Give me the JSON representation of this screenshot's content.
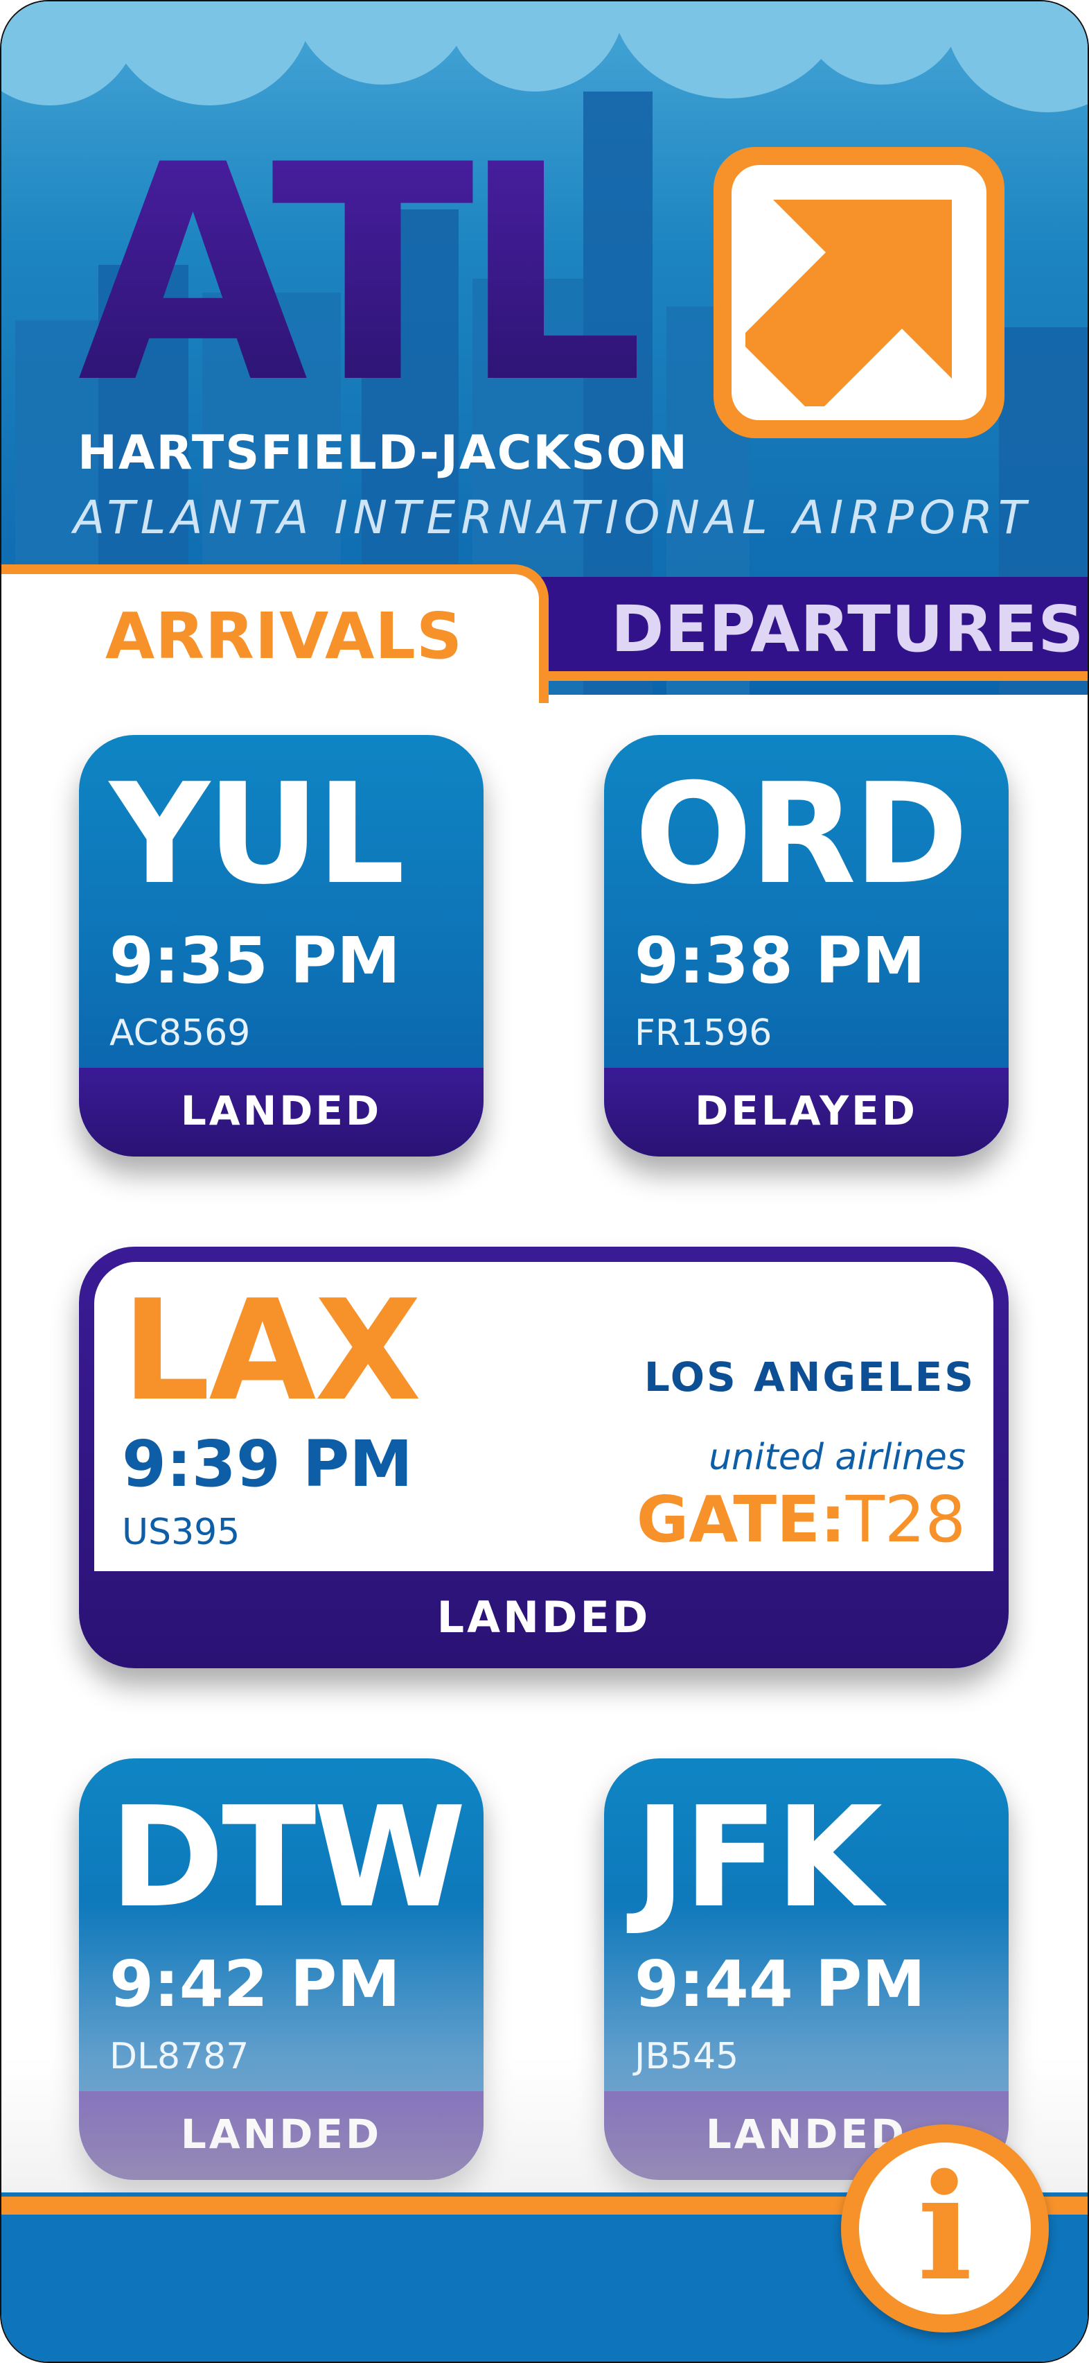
{
  "header": {
    "airport_code": "ATL",
    "name_line1": "HARTSFIELD-JACKSON",
    "name_line2": "ATLANTA INTERNATIONAL AIRPORT",
    "logo_icon": "arrow-up-right-icon"
  },
  "tabs": [
    {
      "label": "ARRIVALS",
      "active": true
    },
    {
      "label": "DEPARTURES",
      "active": false
    }
  ],
  "flights": [
    {
      "code": "YUL",
      "time": "9:35 PM",
      "flight": "AC8569",
      "status": "LANDED"
    },
    {
      "code": "ORD",
      "time": "9:38 PM",
      "flight": "FR1596",
      "status": "DELAYED"
    },
    {
      "code": "LAX",
      "time": "9:39 PM",
      "flight": "US395",
      "status": "LANDED",
      "city": "LOS ANGELES",
      "airline": "united airlines",
      "gate_label": "GATE:",
      "gate": "T28"
    },
    {
      "code": "DTW",
      "time": "9:42 PM",
      "flight": "DL8787",
      "status": "LANDED"
    },
    {
      "code": "JFK",
      "time": "9:44 PM",
      "flight": "JB545",
      "status": "LANDED"
    }
  ],
  "info_button": {
    "glyph": "i",
    "icon": "info-icon"
  },
  "colors": {
    "orange": "#f7922b",
    "purple": "#32128a",
    "blue": "#0d70b5",
    "white": "#ffffff"
  }
}
